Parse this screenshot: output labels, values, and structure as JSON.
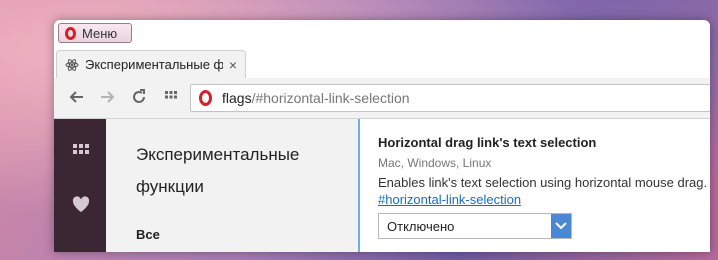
{
  "menu": {
    "label": "Меню"
  },
  "tab": {
    "title": "Экспериментальные фун",
    "close": "×"
  },
  "newtab": {
    "symbol": "+"
  },
  "address": {
    "scheme": "flags",
    "path": "/#horizontal-link-selection"
  },
  "left": {
    "title": "Экспериментальные функции",
    "category_all": "Все"
  },
  "flag": {
    "title": "Horizontal drag link's text selection",
    "platforms": "Mac, Windows, Linux",
    "description": "Enables link's text selection using horizontal mouse drag.",
    "link": "#horizontal-link-selection",
    "select_value": "Отключено"
  },
  "colors": {
    "opera_red": "#d61f26",
    "sidebar": "#3b2633",
    "accent": "#4a88d4",
    "link": "#1a6cc4"
  },
  "icons": [
    "opera-logo-icon",
    "atom-icon",
    "close-icon",
    "plus-icon",
    "back-arrow-icon",
    "forward-arrow-icon",
    "reload-icon",
    "speed-dial-grid-icon",
    "speed-dial-sidebar-icon",
    "heart-icon",
    "chevron-down-icon"
  ]
}
